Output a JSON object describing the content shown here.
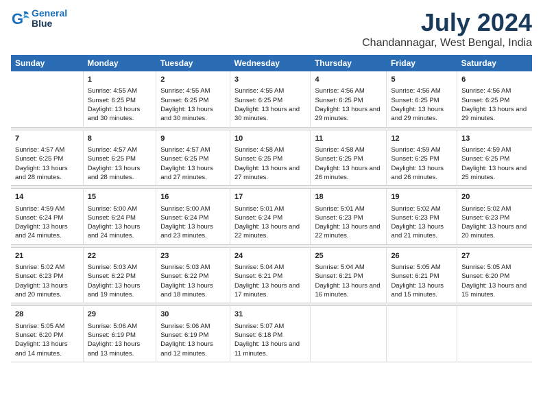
{
  "logo": {
    "line1": "General",
    "line2": "Blue"
  },
  "title": "July 2024",
  "subtitle": "Chandannagar, West Bengal, India",
  "days_header": [
    "Sunday",
    "Monday",
    "Tuesday",
    "Wednesday",
    "Thursday",
    "Friday",
    "Saturday"
  ],
  "weeks": [
    [
      {
        "day": "",
        "sunrise": "",
        "sunset": "",
        "daylight": ""
      },
      {
        "day": "1",
        "sunrise": "Sunrise: 4:55 AM",
        "sunset": "Sunset: 6:25 PM",
        "daylight": "Daylight: 13 hours and 30 minutes."
      },
      {
        "day": "2",
        "sunrise": "Sunrise: 4:55 AM",
        "sunset": "Sunset: 6:25 PM",
        "daylight": "Daylight: 13 hours and 30 minutes."
      },
      {
        "day": "3",
        "sunrise": "Sunrise: 4:55 AM",
        "sunset": "Sunset: 6:25 PM",
        "daylight": "Daylight: 13 hours and 30 minutes."
      },
      {
        "day": "4",
        "sunrise": "Sunrise: 4:56 AM",
        "sunset": "Sunset: 6:25 PM",
        "daylight": "Daylight: 13 hours and 29 minutes."
      },
      {
        "day": "5",
        "sunrise": "Sunrise: 4:56 AM",
        "sunset": "Sunset: 6:25 PM",
        "daylight": "Daylight: 13 hours and 29 minutes."
      },
      {
        "day": "6",
        "sunrise": "Sunrise: 4:56 AM",
        "sunset": "Sunset: 6:25 PM",
        "daylight": "Daylight: 13 hours and 29 minutes."
      }
    ],
    [
      {
        "day": "7",
        "sunrise": "Sunrise: 4:57 AM",
        "sunset": "Sunset: 6:25 PM",
        "daylight": "Daylight: 13 hours and 28 minutes."
      },
      {
        "day": "8",
        "sunrise": "Sunrise: 4:57 AM",
        "sunset": "Sunset: 6:25 PM",
        "daylight": "Daylight: 13 hours and 28 minutes."
      },
      {
        "day": "9",
        "sunrise": "Sunrise: 4:57 AM",
        "sunset": "Sunset: 6:25 PM",
        "daylight": "Daylight: 13 hours and 27 minutes."
      },
      {
        "day": "10",
        "sunrise": "Sunrise: 4:58 AM",
        "sunset": "Sunset: 6:25 PM",
        "daylight": "Daylight: 13 hours and 27 minutes."
      },
      {
        "day": "11",
        "sunrise": "Sunrise: 4:58 AM",
        "sunset": "Sunset: 6:25 PM",
        "daylight": "Daylight: 13 hours and 26 minutes."
      },
      {
        "day": "12",
        "sunrise": "Sunrise: 4:59 AM",
        "sunset": "Sunset: 6:25 PM",
        "daylight": "Daylight: 13 hours and 26 minutes."
      },
      {
        "day": "13",
        "sunrise": "Sunrise: 4:59 AM",
        "sunset": "Sunset: 6:25 PM",
        "daylight": "Daylight: 13 hours and 25 minutes."
      }
    ],
    [
      {
        "day": "14",
        "sunrise": "Sunrise: 4:59 AM",
        "sunset": "Sunset: 6:24 PM",
        "daylight": "Daylight: 13 hours and 24 minutes."
      },
      {
        "day": "15",
        "sunrise": "Sunrise: 5:00 AM",
        "sunset": "Sunset: 6:24 PM",
        "daylight": "Daylight: 13 hours and 24 minutes."
      },
      {
        "day": "16",
        "sunrise": "Sunrise: 5:00 AM",
        "sunset": "Sunset: 6:24 PM",
        "daylight": "Daylight: 13 hours and 23 minutes."
      },
      {
        "day": "17",
        "sunrise": "Sunrise: 5:01 AM",
        "sunset": "Sunset: 6:24 PM",
        "daylight": "Daylight: 13 hours and 22 minutes."
      },
      {
        "day": "18",
        "sunrise": "Sunrise: 5:01 AM",
        "sunset": "Sunset: 6:23 PM",
        "daylight": "Daylight: 13 hours and 22 minutes."
      },
      {
        "day": "19",
        "sunrise": "Sunrise: 5:02 AM",
        "sunset": "Sunset: 6:23 PM",
        "daylight": "Daylight: 13 hours and 21 minutes."
      },
      {
        "day": "20",
        "sunrise": "Sunrise: 5:02 AM",
        "sunset": "Sunset: 6:23 PM",
        "daylight": "Daylight: 13 hours and 20 minutes."
      }
    ],
    [
      {
        "day": "21",
        "sunrise": "Sunrise: 5:02 AM",
        "sunset": "Sunset: 6:23 PM",
        "daylight": "Daylight: 13 hours and 20 minutes."
      },
      {
        "day": "22",
        "sunrise": "Sunrise: 5:03 AM",
        "sunset": "Sunset: 6:22 PM",
        "daylight": "Daylight: 13 hours and 19 minutes."
      },
      {
        "day": "23",
        "sunrise": "Sunrise: 5:03 AM",
        "sunset": "Sunset: 6:22 PM",
        "daylight": "Daylight: 13 hours and 18 minutes."
      },
      {
        "day": "24",
        "sunrise": "Sunrise: 5:04 AM",
        "sunset": "Sunset: 6:21 PM",
        "daylight": "Daylight: 13 hours and 17 minutes."
      },
      {
        "day": "25",
        "sunrise": "Sunrise: 5:04 AM",
        "sunset": "Sunset: 6:21 PM",
        "daylight": "Daylight: 13 hours and 16 minutes."
      },
      {
        "day": "26",
        "sunrise": "Sunrise: 5:05 AM",
        "sunset": "Sunset: 6:21 PM",
        "daylight": "Daylight: 13 hours and 15 minutes."
      },
      {
        "day": "27",
        "sunrise": "Sunrise: 5:05 AM",
        "sunset": "Sunset: 6:20 PM",
        "daylight": "Daylight: 13 hours and 15 minutes."
      }
    ],
    [
      {
        "day": "28",
        "sunrise": "Sunrise: 5:05 AM",
        "sunset": "Sunset: 6:20 PM",
        "daylight": "Daylight: 13 hours and 14 minutes."
      },
      {
        "day": "29",
        "sunrise": "Sunrise: 5:06 AM",
        "sunset": "Sunset: 6:19 PM",
        "daylight": "Daylight: 13 hours and 13 minutes."
      },
      {
        "day": "30",
        "sunrise": "Sunrise: 5:06 AM",
        "sunset": "Sunset: 6:19 PM",
        "daylight": "Daylight: 13 hours and 12 minutes."
      },
      {
        "day": "31",
        "sunrise": "Sunrise: 5:07 AM",
        "sunset": "Sunset: 6:18 PM",
        "daylight": "Daylight: 13 hours and 11 minutes."
      },
      {
        "day": "",
        "sunrise": "",
        "sunset": "",
        "daylight": ""
      },
      {
        "day": "",
        "sunrise": "",
        "sunset": "",
        "daylight": ""
      },
      {
        "day": "",
        "sunrise": "",
        "sunset": "",
        "daylight": ""
      }
    ]
  ]
}
